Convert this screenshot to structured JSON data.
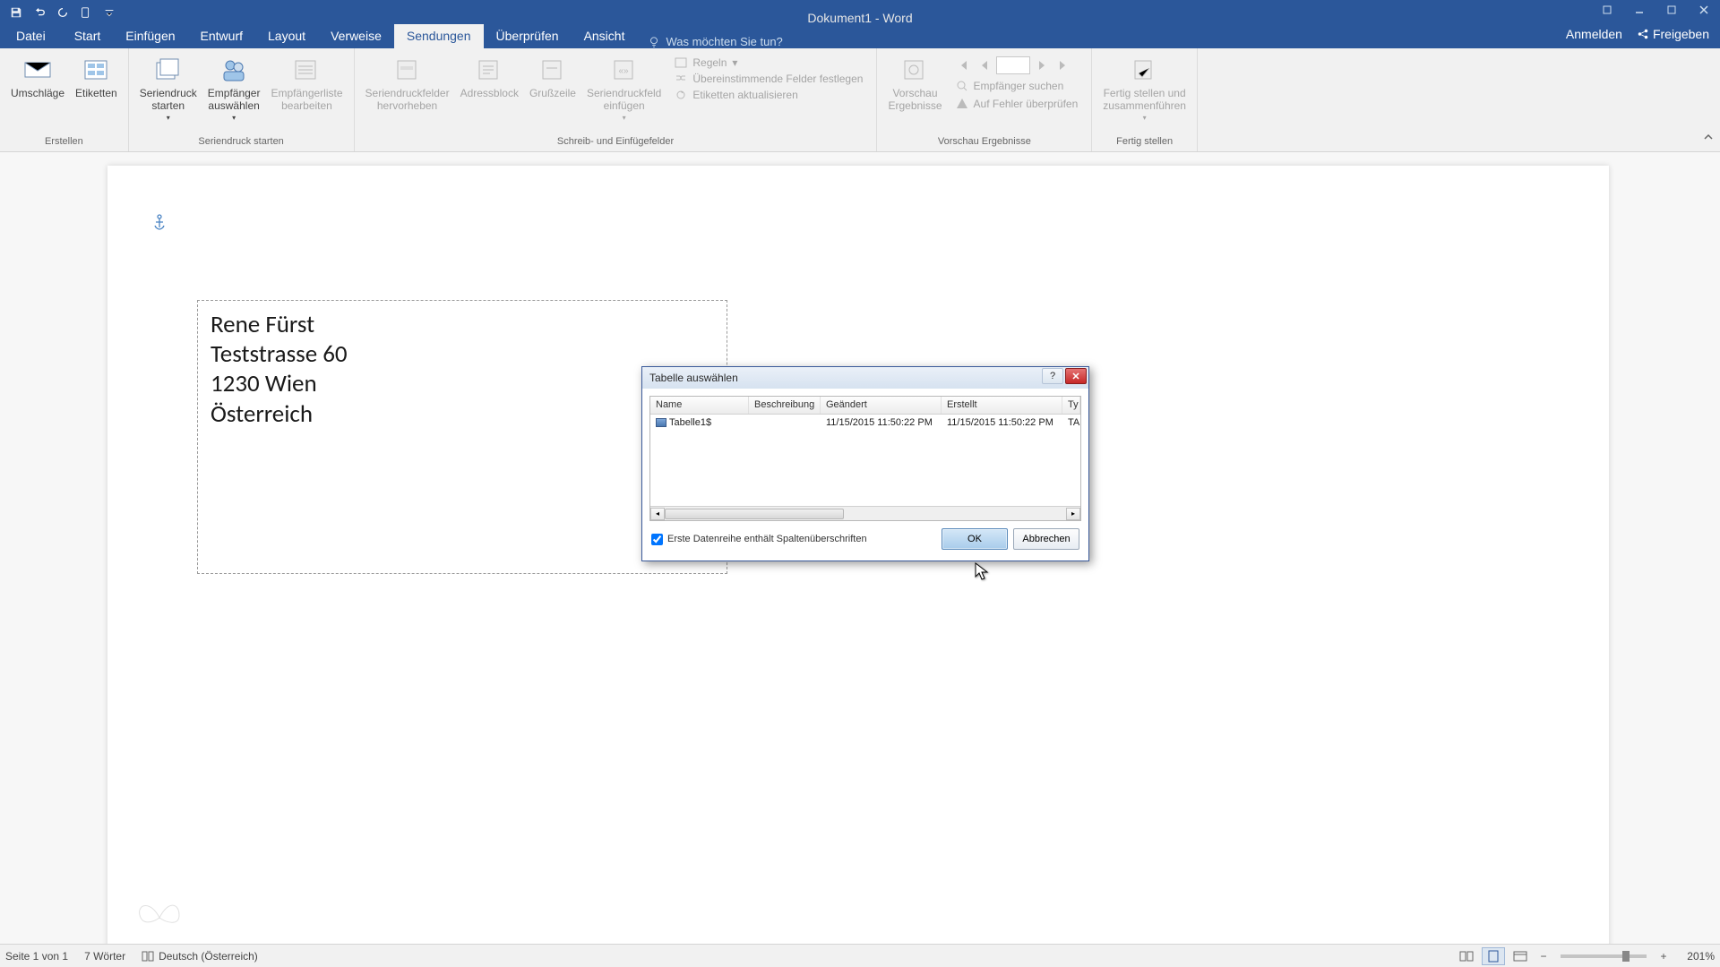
{
  "app_title": "Dokument1 - Word",
  "tabs": {
    "file": "Datei",
    "items": [
      "Start",
      "Einfügen",
      "Entwurf",
      "Layout",
      "Verweise",
      "Sendungen",
      "Überprüfen",
      "Ansicht"
    ],
    "active": "Sendungen",
    "tell_me_placeholder": "Was möchten Sie tun?"
  },
  "account": {
    "login": "Anmelden",
    "share": "Freigeben"
  },
  "ribbon": {
    "groups": {
      "erstellen": {
        "label": "Erstellen",
        "envelopes": "Umschläge",
        "labels": "Etiketten"
      },
      "start": {
        "label": "Seriendruck starten",
        "start_merge": "Seriendruck\nstarten",
        "select_recipients": "Empfänger\nauswählen",
        "edit_recipients": "Empfängerliste\nbearbeiten"
      },
      "fields": {
        "label": "Schreib- und Einfügefelder",
        "highlight": "Seriendruckfelder\nhervorheben",
        "address": "Adressblock",
        "greeting": "Grußzeile",
        "insert_field": "Seriendruckfeld\neinfügen",
        "rules": "Regeln",
        "match": "Übereinstimmende Felder festlegen",
        "update": "Etiketten aktualisieren"
      },
      "preview": {
        "label": "Vorschau Ergebnisse",
        "preview_results": "Vorschau\nErgebnisse",
        "find": "Empfänger suchen",
        "errors": "Auf Fehler überprüfen"
      },
      "finish": {
        "label": "Fertig stellen",
        "finish_merge": "Fertig stellen und\nzusammenführen"
      }
    }
  },
  "document": {
    "lines": [
      "Rene Fürst",
      "Teststrasse 60",
      "1230 Wien",
      "Österreich"
    ]
  },
  "dialog": {
    "title": "Tabelle auswählen",
    "columns": {
      "name": "Name",
      "desc": "Beschreibung",
      "modified": "Geändert",
      "created": "Erstellt",
      "type_partial": "Ty"
    },
    "row": {
      "name": "Tabelle1$",
      "desc": "",
      "modified": "11/15/2015 11:50:22 PM",
      "created": "11/15/2015 11:50:22 PM",
      "type_partial": "TA"
    },
    "checkbox_label": "Erste Datenreihe enthält Spaltenüberschriften",
    "ok": "OK",
    "cancel": "Abbrechen"
  },
  "statusbar": {
    "page": "Seite 1 von 1",
    "words": "7 Wörter",
    "lang": "Deutsch (Österreich)",
    "zoom": "201%"
  }
}
